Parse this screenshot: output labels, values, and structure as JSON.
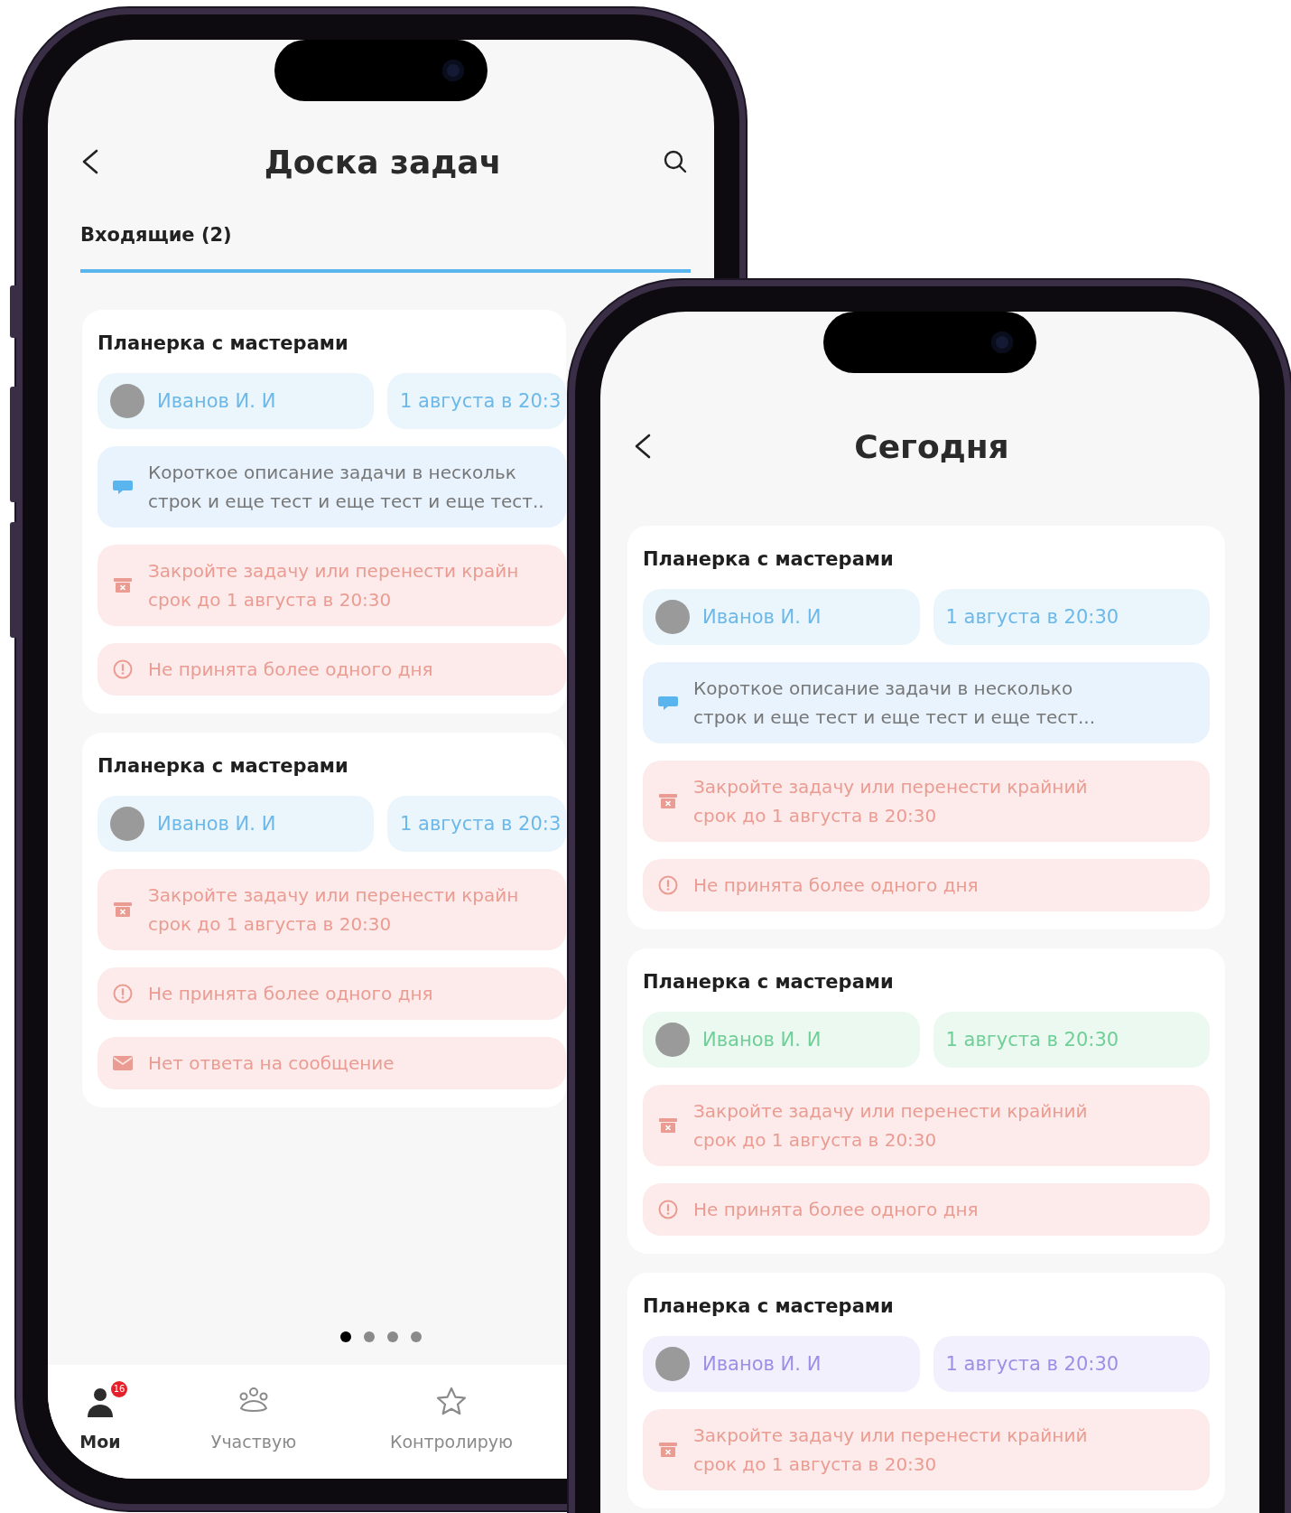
{
  "phones": [
    {
      "title": "Доска задач",
      "actions": [
        {
          "kind": "search"
        }
      ],
      "tabs": [
        {
          "label": "Входящие (2)",
          "selected": true
        }
      ],
      "tasks": [
        {
          "title": "Планерка с мастерами",
          "color": "#6cb8e8",
          "assignee": "Иванов И. И",
          "due": "1 августа в 20:3",
          "notes": [
            {
              "kind": "description",
              "text": "Короткое описание задачи в нескольк\nстрок и еще тест и еще тест и еще тест.."
            },
            {
              "kind": "deadline",
              "text": "Закройте задачу или перенести крайн\nсрок до 1 августа в 20:30"
            },
            {
              "kind": "not_accepted",
              "text": "Не принята более одного дня"
            }
          ]
        },
        {
          "title": "Планерка с мастерами",
          "color": "#6cb8e8",
          "assignee": "Иванов И. И",
          "due": "1 августа в 20:3",
          "notes": [
            {
              "kind": "deadline",
              "text": "Закройте задачу или перенести крайн\nсрок до 1 августа в 20:30"
            },
            {
              "kind": "not_accepted",
              "text": "Не принята более одного дня"
            },
            {
              "kind": "no_reply",
              "text": "Нет ответа на сообщение"
            }
          ]
        }
      ],
      "pager": [
        {
          "selected": true
        },
        {
          "selected": false
        },
        {
          "selected": false
        },
        {
          "selected": false
        }
      ],
      "nav": [
        {
          "label": "Мои",
          "badge": "16",
          "selected": true
        },
        {
          "label": "Участвую",
          "selected": false
        },
        {
          "label": "Контролирую",
          "selected": false
        }
      ]
    },
    {
      "title": "Сегодня",
      "tasks": [
        {
          "title": "Планерка с мастерами",
          "color": "#6cb8e8",
          "assignee": "Иванов И. И",
          "due": "1 августа в 20:30",
          "notes": [
            {
              "kind": "description",
              "text": "Короткое описание задачи в несколько\nстрок и еще тест и еще тест и еще тест..."
            },
            {
              "kind": "deadline",
              "text": "Закройте задачу или перенести крайний\nсрок до 1 августа в 20:30"
            },
            {
              "kind": "not_accepted",
              "text": "Не принята более одного дня"
            }
          ]
        },
        {
          "title": "Планерка с мастерами",
          "color": "#6fcf97",
          "assignee": "Иванов И. И",
          "due": "1 августа в 20:30",
          "notes": [
            {
              "kind": "deadline",
              "text": "Закройте задачу или перенести крайний\nсрок до 1 августа в 20:30"
            },
            {
              "kind": "not_accepted",
              "text": "Не принята более одного дня"
            }
          ]
        },
        {
          "title": "Планерка с мастерами",
          "color": "#9d8fe6",
          "assignee": "Иванов И. И",
          "due": "1 августа в 20:30",
          "notes": [
            {
              "kind": "deadline",
              "text": "Закройте задачу или перенести крайний\nсрок до 1 августа в 20:30"
            }
          ]
        }
      ]
    }
  ]
}
